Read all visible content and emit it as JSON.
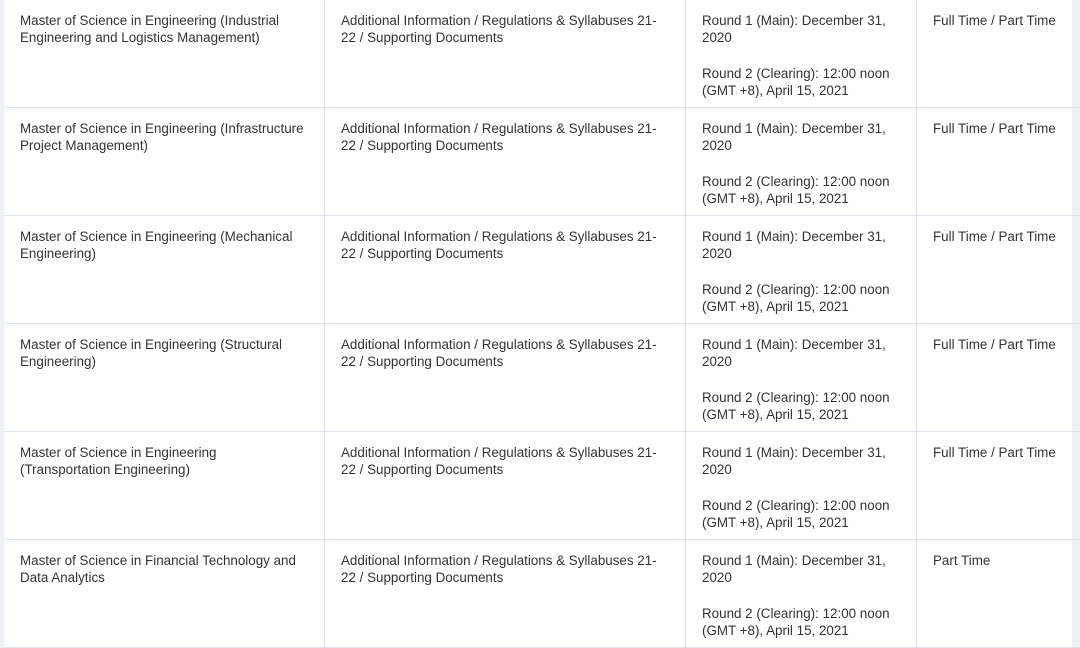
{
  "sep": " / ",
  "rows": [
    {
      "programme": "Master of Science in Engineering (Industrial Engineering and Logistics Management)",
      "links": [
        "Additional Information",
        "Regulations & Syllabuses 21-22",
        "Supporting Documents"
      ],
      "round1": "Round 1 (Main): December 31, 2020",
      "round2": "Round 2 (Clearing): 12:00 noon (GMT +8), April 15, 2021",
      "mode": "Full Time / Part Time"
    },
    {
      "programme": "Master of Science in Engineering (Infrastructure Project Management)",
      "links": [
        "Additional Information",
        "Regulations & Syllabuses 21-22",
        "Supporting Documents"
      ],
      "round1": "Round 1 (Main): December 31, 2020",
      "round2": "Round 2 (Clearing): 12:00 noon (GMT +8), April 15, 2021",
      "mode": "Full Time / Part Time"
    },
    {
      "programme": "Master of Science in Engineering (Mechanical Engineering)",
      "links": [
        "Additional Information",
        "Regulations & Syllabuses 21-22",
        "Supporting Documents"
      ],
      "round1": "Round 1 (Main): December 31, 2020",
      "round2": "Round 2 (Clearing): 12:00 noon (GMT +8), April 15, 2021",
      "mode": "Full Time / Part Time"
    },
    {
      "programme": "Master of Science in Engineering (Structural Engineering)",
      "links": [
        "Additional Information",
        "Regulations & Syllabuses 21-22",
        "Supporting Documents"
      ],
      "round1": "Round 1 (Main): December 31, 2020",
      "round2": "Round 2 (Clearing): 12:00 noon (GMT +8), April 15, 2021",
      "mode": "Full Time / Part Time"
    },
    {
      "programme": "Master of Science in Engineering (Transportation Engineering)",
      "links": [
        "Additional Information",
        "Regulations & Syllabuses 21-22",
        "Supporting Documents"
      ],
      "round1": "Round 1 (Main): December 31, 2020",
      "round2": "Round 2 (Clearing): 12:00 noon (GMT +8), April 15, 2021",
      "mode": "Full Time / Part Time"
    },
    {
      "programme": "Master of Science in Financial Technology and Data Analytics",
      "links": [
        "Additional Information",
        "Regulations & Syllabuses 21-22",
        "Supporting Documents"
      ],
      "round1": "Round 1 (Main): December 31, 2020",
      "round2": "Round 2 (Clearing): 12:00 noon (GMT +8), April 15, 2021",
      "mode": "Part Time"
    }
  ]
}
